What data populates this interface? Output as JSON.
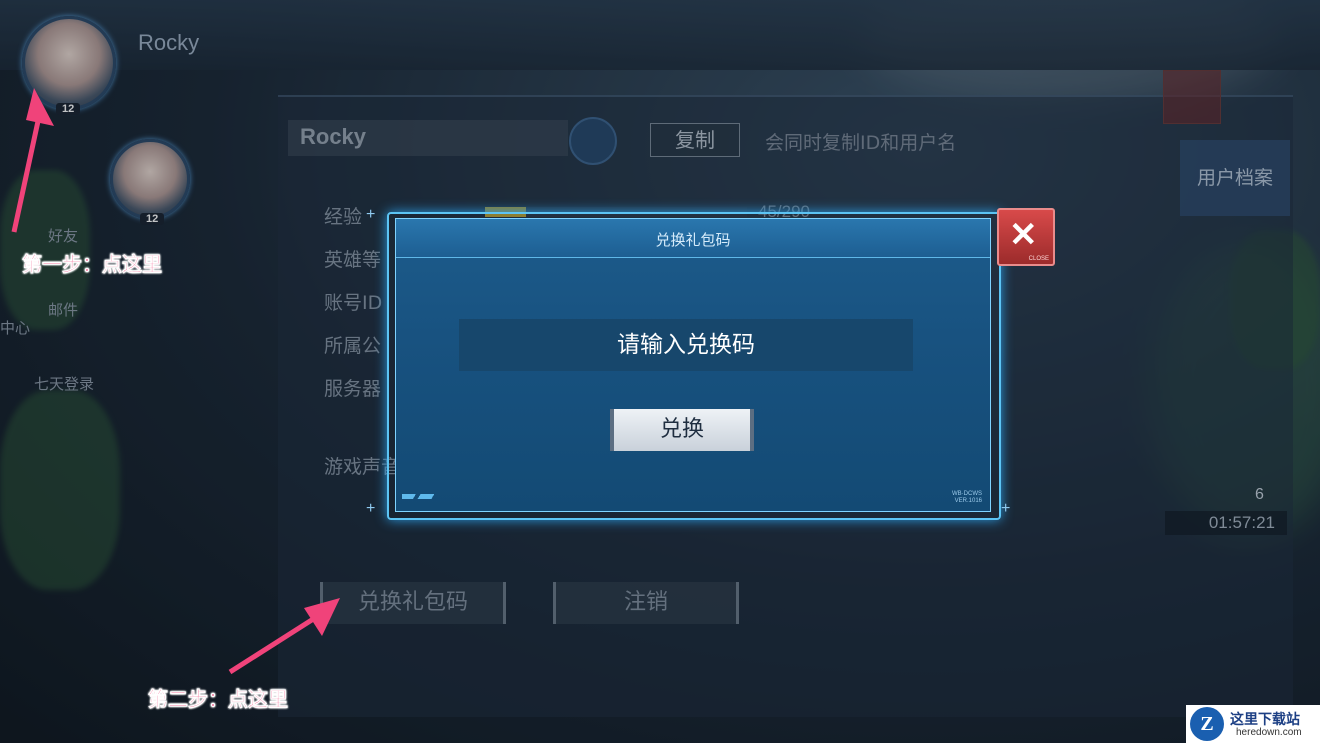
{
  "player": {
    "name": "Rocky",
    "level": "12"
  },
  "friend_level": "12",
  "sidebar": {
    "friends": "好友",
    "mail": "邮件",
    "center": "中心",
    "seven_day_login": "七天登录"
  },
  "profile": {
    "name": "Rocky",
    "copy_label": "复制",
    "copy_hint": "会同时复制ID和用户名",
    "exp_label": "经验",
    "exp_value": "45/290",
    "exp_fraction": 0.155,
    "hero_level_label": "英雄等",
    "account_id_label": "账号ID",
    "guild_label": "所属公",
    "server_label": "服务器",
    "sound_label": "游戏声音",
    "profile_button": "用户档案",
    "redeem_button": "兑换礼包码",
    "logout_button": "注销"
  },
  "dialog": {
    "title": "兑换礼包码",
    "input_placeholder": "请输入兑换码",
    "redeem_label": "兑换",
    "close_caption": "CLOSE",
    "close_symbol": "✕",
    "version_line1": "WB·DCWS",
    "version_line2": "VER.1016"
  },
  "right_panel": {
    "hero_count": "6",
    "timer": "01:57:21"
  },
  "annotations": {
    "step1": "第一步：点这里",
    "step2": "第二步：点这里"
  },
  "watermark": {
    "logo_letter": "Z",
    "name": "这里下载站",
    "url": "heredown.com"
  },
  "colors": {
    "accent": "#5cc4f4",
    "annotation": "#f0437a",
    "dialog_bg": "#185280"
  }
}
